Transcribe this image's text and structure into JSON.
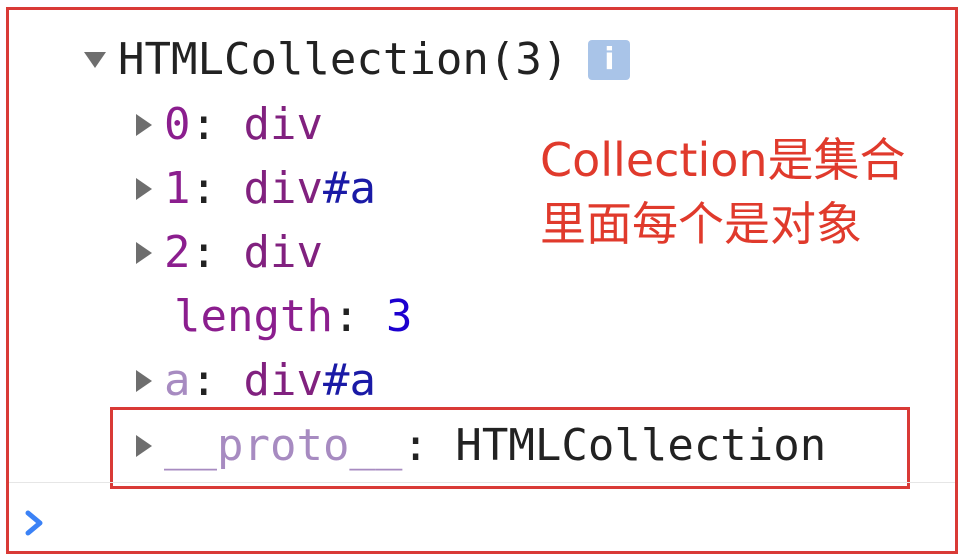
{
  "console": {
    "root": {
      "label": "HTMLCollection(3)",
      "info_icon": "info-icon",
      "info_glyph": "i"
    },
    "entries": [
      {
        "key": "0",
        "sep": ": ",
        "tag": "div",
        "id": ""
      },
      {
        "key": "1",
        "sep": ": ",
        "tag": "div",
        "id": "#a"
      },
      {
        "key": "2",
        "sep": ": ",
        "tag": "div",
        "id": ""
      }
    ],
    "length": {
      "key": "length",
      "sep": ": ",
      "value": "3"
    },
    "named": {
      "key": "a",
      "sep": ": ",
      "tag": "div",
      "id": "#a"
    },
    "proto": {
      "key": "__proto__",
      "sep": ": ",
      "value": "HTMLCollection"
    },
    "prompt_icon": "chevron-right-icon"
  },
  "annotation": {
    "line1": "Collection是集合",
    "line2": "里面每个是对象"
  },
  "colors": {
    "annotation": "#e03a2c",
    "border": "#d93a36",
    "prompt": "#3b82f6"
  }
}
